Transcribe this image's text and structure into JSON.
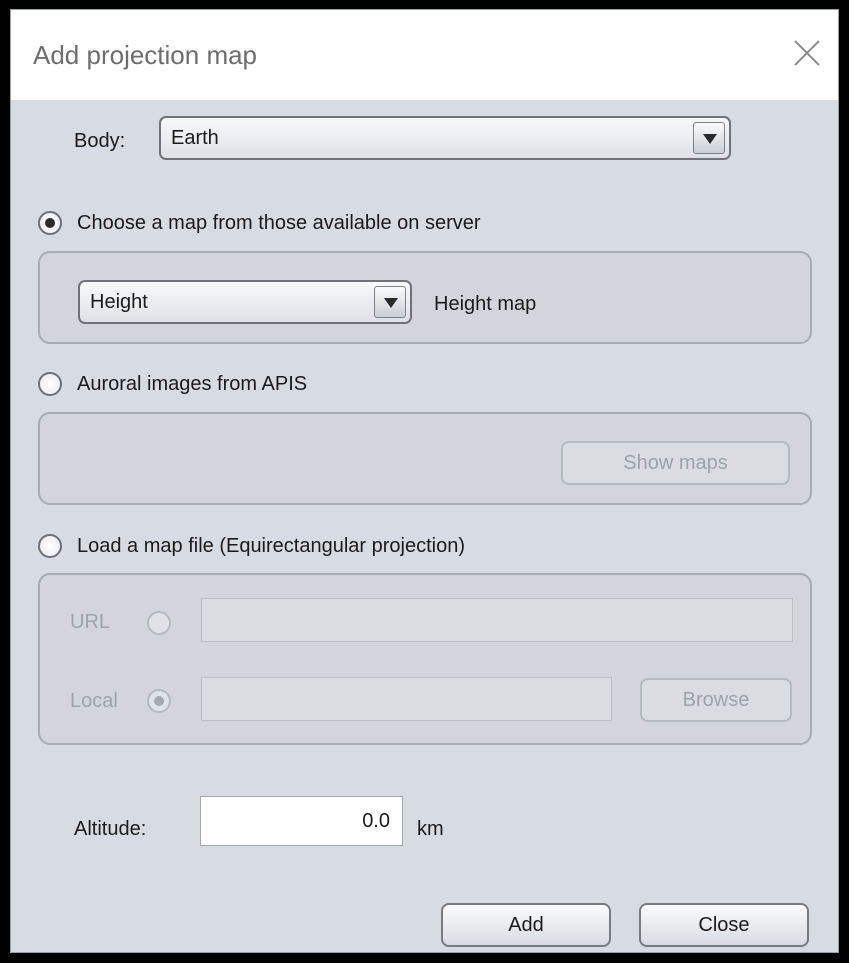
{
  "window": {
    "title": "Add projection map"
  },
  "body_row": {
    "label": "Body:",
    "selected": "Earth"
  },
  "server": {
    "radio_label": "Choose a map from those available on server",
    "selected": true,
    "combo_value": "Height",
    "description": "Height map"
  },
  "apis": {
    "radio_label": "Auroral images from APIS",
    "selected": false,
    "show_maps_label": "Show maps"
  },
  "file": {
    "radio_label": "Load a map file (Equirectangular projection)",
    "selected": false,
    "url_label": "URL",
    "url_value": "",
    "local_label": "Local",
    "local_value": "",
    "browse_label": "Browse"
  },
  "altitude": {
    "label": "Altitude:",
    "value": "0.0",
    "unit": "km"
  },
  "footer": {
    "add_label": "Add",
    "close_label": "Close"
  }
}
